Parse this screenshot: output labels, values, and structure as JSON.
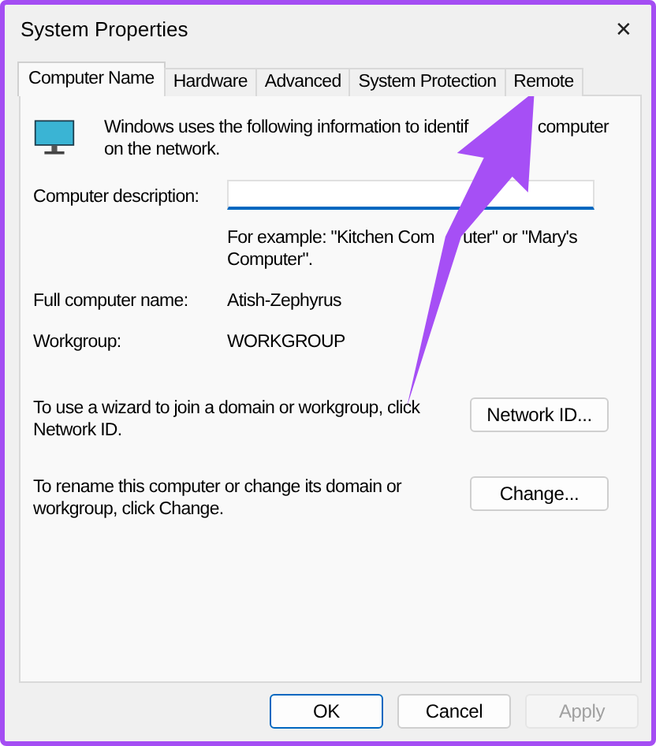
{
  "window": {
    "title": "System Properties",
    "close": "✕"
  },
  "tabs": [
    {
      "label": "Computer Name",
      "selected": true
    },
    {
      "label": "Hardware",
      "selected": false
    },
    {
      "label": "Advanced",
      "selected": false
    },
    {
      "label": "System Protection",
      "selected": false
    },
    {
      "label": "Remote",
      "selected": false
    }
  ],
  "intro_lines": [
    [
      "Windows uses the following information to identif",
      "computer"
    ],
    [
      "on the network."
    ]
  ],
  "description": {
    "label": "Computer description:",
    "hint_lines": [
      [
        "For example: \"Kitchen Com",
        "uter\" or \"Mary's"
      ],
      [
        "Computer\"."
      ]
    ]
  },
  "info_rows": [
    {
      "label": "Full computer name:",
      "value": "Atish-Zephyrus"
    },
    {
      "label": "Workgroup:",
      "value": "WORKGROUP"
    }
  ],
  "actions": [
    {
      "text": "To use a wizard to join a domain or workgroup, click Network ID.",
      "button": "Network ID..."
    },
    {
      "text": "To rename this computer or change its domain or workgroup, click Change.",
      "button": "Change..."
    }
  ],
  "buttons": [
    {
      "label": "OK",
      "default": true,
      "disabled": false
    },
    {
      "label": "Cancel",
      "default": false,
      "disabled": false
    },
    {
      "label": "Apply",
      "default": false,
      "disabled": true
    }
  ],
  "annotations": [
    {
      "kind": "arrow"
    }
  ]
}
